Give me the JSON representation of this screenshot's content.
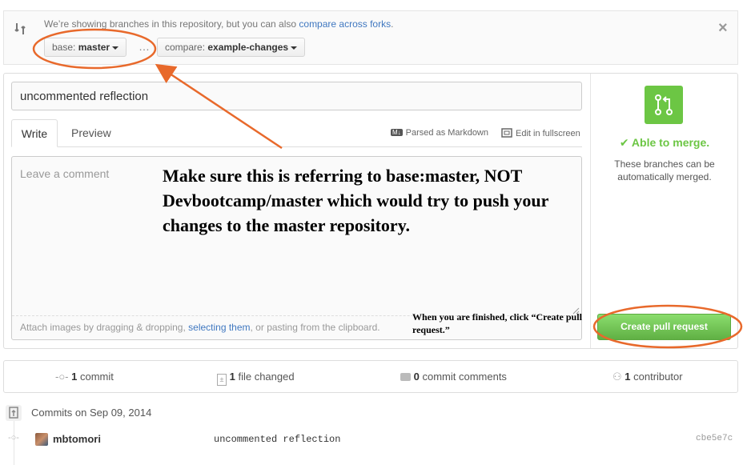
{
  "range_bar": {
    "info_text": "We’re showing branches in this repository, but you can also ",
    "compare_forks_link": "compare across forks",
    "info_end": ".",
    "base_label": "base: ",
    "base_value": "master",
    "ellipsis": "…",
    "compare_label": "compare: ",
    "compare_value": "example-changes",
    "close_glyph": "×"
  },
  "form": {
    "title_value": "uncommented reflection",
    "tab_write": "Write",
    "tab_preview": "Preview",
    "markdown_badge": "M↓",
    "markdown_label": "Parsed as Markdown",
    "fullscreen_label": "Edit in fullscreen",
    "comment_placeholder": "Leave a comment",
    "attach_text_1": "Attach images by dragging & dropping, ",
    "attach_link": "selecting them",
    "attach_text_2": ", or pasting from the clipboard."
  },
  "merge": {
    "status": "Able to merge.",
    "check_glyph": "✔",
    "description": "These branches can be automatically merged.",
    "create_button": "Create pull request"
  },
  "annotations": {
    "main_note": "Make sure this is referring to base:master, NOT Devbootcamp/master which would try to push your changes to the master repository.",
    "finish_note": "When you are finished, click “Create pull request.”"
  },
  "stats": {
    "commits_count": "1",
    "commits_label": " commit",
    "files_count": "1",
    "files_label": " file changed",
    "comments_count": "0",
    "comments_label": " commit comments",
    "contributors_count": "1",
    "contributors_label": " contributor"
  },
  "commits": {
    "date_heading": "Commits on Sep 09, 2014",
    "author": "mbtomori",
    "message": "uncommented reflection",
    "sha": "cbe5e7c"
  },
  "colors": {
    "link": "#4078c0",
    "green": "#6cc644",
    "annotation_orange": "#e8692b"
  }
}
